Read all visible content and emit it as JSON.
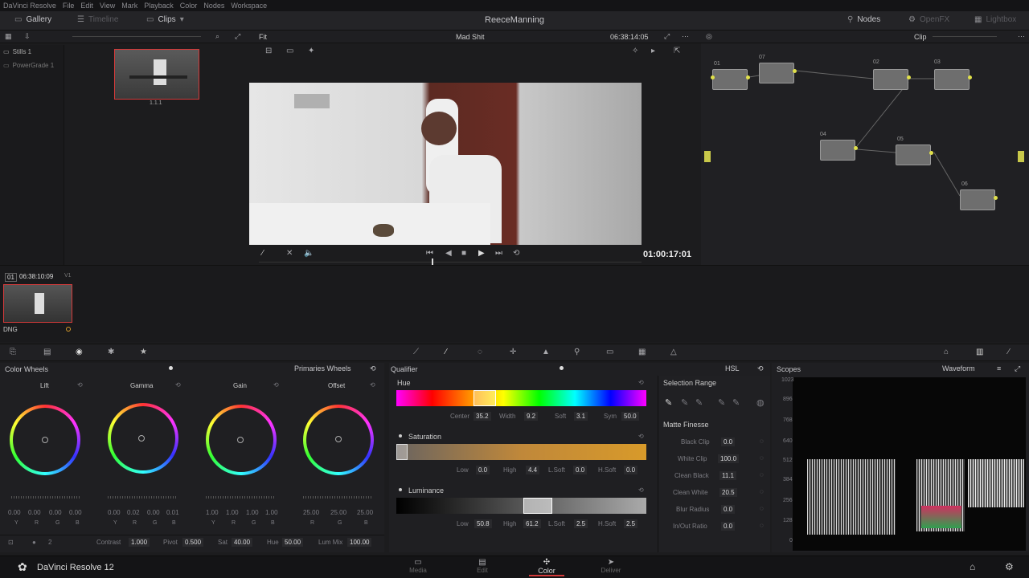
{
  "menu": [
    "DaVinci Resolve",
    "File",
    "Edit",
    "View",
    "Mark",
    "Playback",
    "Color",
    "Nodes",
    "Workspace"
  ],
  "topbar": {
    "gallery_label": "Gallery",
    "timeline_label": "Timeline",
    "clips_label": "Clips",
    "project_title": "ReeceManning",
    "nodes_label": "Nodes",
    "openfx_label": "OpenFX",
    "lightbox_label": "Lightbox"
  },
  "subbar": {
    "fit": "Fit",
    "clip_name": "Mad Shit",
    "timecode": "06:38:14:05",
    "mode": "Clip"
  },
  "gallery": {
    "stills": "Stills 1",
    "powergrade": "PowerGrade 1",
    "still_label": "1.1.1"
  },
  "viewer": {
    "timecode": "01:00:17:01"
  },
  "nodes": {
    "labels": [
      "01",
      "07",
      "02",
      "03",
      "04",
      "05",
      "06"
    ]
  },
  "timeline": {
    "clip_num": "01",
    "clip_tc": "06:38:10:09",
    "clip_track": "V1",
    "clip_codec": "DNG"
  },
  "wheels": {
    "title": "Color Wheels",
    "mode": "Primaries Wheels",
    "items": [
      {
        "name": "Lift",
        "values": [
          "0.00",
          "0.00",
          "0.00",
          "0.00"
        ],
        "channels": [
          "Y",
          "R",
          "G",
          "B"
        ]
      },
      {
        "name": "Gamma",
        "values": [
          "0.00",
          "0.02",
          "0.00",
          "0.01"
        ],
        "channels": [
          "Y",
          "R",
          "G",
          "B"
        ]
      },
      {
        "name": "Gain",
        "values": [
          "1.00",
          "1.00",
          "1.00",
          "1.00"
        ],
        "channels": [
          "Y",
          "R",
          "G",
          "B"
        ]
      },
      {
        "name": "Offset",
        "values": [
          "25.00",
          "25.00",
          "25.00"
        ],
        "channels": [
          "R",
          "G",
          "B"
        ]
      }
    ],
    "footer": {
      "page": "2",
      "contrast_label": "Contrast",
      "contrast": "1.000",
      "pivot_label": "Pivot",
      "pivot": "0.500",
      "sat_label": "Sat",
      "sat": "40.00",
      "hue_label": "Hue",
      "hue": "50.00",
      "lummix_label": "Lum Mix",
      "lummix": "100.00"
    }
  },
  "qualifier": {
    "title": "Qualifier",
    "mode": "HSL",
    "hue": {
      "label": "Hue",
      "center_label": "Center",
      "center": "35.2",
      "width_label": "Width",
      "width": "9.2",
      "soft_label": "Soft",
      "soft": "3.1",
      "sym_label": "Sym",
      "sym": "50.0"
    },
    "sat": {
      "label": "Saturation",
      "low_label": "Low",
      "low": "0.0",
      "high_label": "High",
      "high": "4.4",
      "lsoft_label": "L.Soft",
      "lsoft": "0.0",
      "hsoft_label": "H.Soft",
      "hsoft": "0.0"
    },
    "lum": {
      "label": "Luminance",
      "low_label": "Low",
      "low": "50.8",
      "high_label": "High",
      "high": "61.2",
      "lsoft_label": "L.Soft",
      "lsoft": "2.5",
      "hsoft_label": "H.Soft",
      "hsoft": "2.5"
    },
    "selection_range": "Selection Range",
    "matte_finesse": "Matte Finesse",
    "finesse": [
      {
        "label": "Black Clip",
        "value": "0.0"
      },
      {
        "label": "White Clip",
        "value": "100.0"
      },
      {
        "label": "Clean Black",
        "value": "11.1"
      },
      {
        "label": "Clean White",
        "value": "20.5"
      },
      {
        "label": "Blur Radius",
        "value": "0.0"
      },
      {
        "label": "In/Out Ratio",
        "value": "0.0"
      }
    ]
  },
  "scopes": {
    "title": "Scopes",
    "mode": "Waveform",
    "ticks": [
      "1023",
      "896",
      "768",
      "640",
      "512",
      "384",
      "256",
      "128",
      "0"
    ]
  },
  "bottom": {
    "app": "DaVinci Resolve 12",
    "pages": [
      "Media",
      "Edit",
      "Color",
      "Deliver"
    ],
    "active_page": "Color"
  }
}
